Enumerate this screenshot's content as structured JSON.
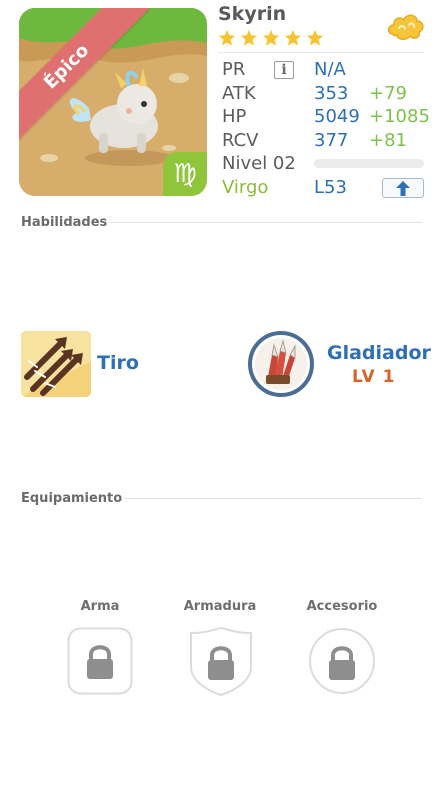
{
  "character": {
    "name": "Skyrin",
    "rarity": "Épico",
    "stars": 5,
    "zodiac_glyph": "♍"
  },
  "stats": {
    "pr": {
      "label": "PR",
      "value": "N/A"
    },
    "atk": {
      "label": "ATK",
      "value": "353",
      "bonus": "+79"
    },
    "hp": {
      "label": "HP",
      "value": "5049",
      "bonus": "+1085"
    },
    "rcv": {
      "label": "RCV",
      "value": "377",
      "bonus": "+81"
    },
    "level": {
      "label": "Nivel 02",
      "progress": 0.0
    },
    "sign": {
      "label": "Virgo",
      "value": "L53"
    }
  },
  "sections": {
    "skills": "Habilidades",
    "equipment": "Equipamiento"
  },
  "skill": {
    "name": "Tiro"
  },
  "leader_skill": {
    "name": "Gladiador",
    "level": "LV 1"
  },
  "equipment": {
    "weapon": "Arma",
    "armor": "Armadura",
    "accessory": "Accesorio"
  },
  "colors": {
    "stat_value": "#2f6fb5",
    "stat_bonus": "#7dc24a",
    "rarity_ribbon": "#e07070",
    "zodiac_badge": "#8fc53b",
    "leader_level": "#d96428"
  }
}
